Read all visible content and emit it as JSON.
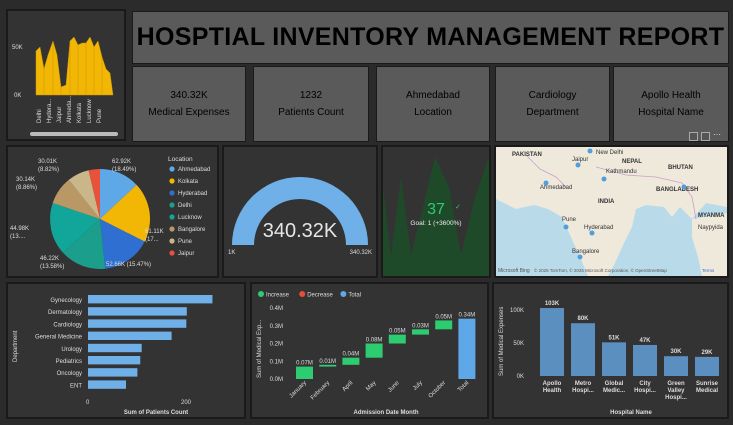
{
  "title": "HOSPTIAL INVENTORY MANAGEMENT REPORT",
  "cards": [
    {
      "value": "340.32K",
      "label": "Medical Expenses"
    },
    {
      "value": "1232",
      "label": "Patients Count"
    },
    {
      "value": "Ahmedabad",
      "label": "Location"
    },
    {
      "value": "Cardiology",
      "label": "Department"
    },
    {
      "value": "Apollo Health",
      "label": "Hospital Name"
    }
  ],
  "area_chart": {
    "y_ticks": [
      "50K",
      "0K"
    ],
    "categories": [
      "Delhi",
      "Hydera...",
      "Jaipur",
      "Ahmeda...",
      "Kolkata",
      "Lucknow",
      "Pune"
    ]
  },
  "pie": {
    "legend_title": "Location",
    "legend": [
      {
        "name": "Ahmedabad",
        "color": "#5fa8e8"
      },
      {
        "name": "Kolkata",
        "color": "#f2b705"
      },
      {
        "name": "Hyderabad",
        "color": "#2f6fd1"
      },
      {
        "name": "Delhi",
        "color": "#1b9e8c"
      },
      {
        "name": "Lucknow",
        "color": "#12a59a"
      },
      {
        "name": "Bangalore",
        "color": "#b99866"
      },
      {
        "name": "Pune",
        "color": "#c9b78a"
      },
      {
        "name": "Jaipur",
        "color": "#e8523c"
      }
    ],
    "labels": {
      "a": "62.92K",
      "a2": "(18.49%)",
      "b": "61.11K",
      "b2": "(17...",
      "c": "52.66K (15.47%)",
      "d": "46.22K",
      "d2": "(13.58%)",
      "e": "44.98K",
      "e2": "(13....",
      "f": "30.14K",
      "f2": "(8.86%)",
      "g": "30.01K",
      "g2": "(8.82%)"
    }
  },
  "gauge": {
    "value": "340.32K",
    "min": "1K",
    "max": "340.32K",
    "fraction": 1.0,
    "color": "#6fb0e8"
  },
  "kpi": {
    "value": "37",
    "goal": "Goal: 1 (+3600%)"
  },
  "map": {
    "labels": [
      "PAKISTAN",
      "New Delhi",
      "Jaipur",
      "Kathmandu",
      "NEPAL",
      "BHUTAN",
      "Ahmedabad",
      "BANGLADESH",
      "INDIA",
      "MYANMA",
      "Pune",
      "Hyderabad",
      "Naypyida",
      "Bangalore"
    ],
    "footer": "Microsoft Bing",
    "copyright": "© 2025 TomTom, © 2025 Microsoft Corporation, © OpenStreetMap",
    "terms": "Terms"
  },
  "bar_dept": {
    "ylabel": "Department",
    "xlabel": "Sum of Patients Count",
    "x_ticks": [
      "0",
      "200"
    ],
    "categories": [
      "Gynecology",
      "Dermatology",
      "Cardiology",
      "General Medicine",
      "Urology",
      "Pediatrics",
      "Oncology",
      "ENT"
    ],
    "values": [
      262,
      208,
      207,
      176,
      113,
      110,
      104,
      80
    ],
    "color": "#6fb0e8"
  },
  "waterfall": {
    "legend": [
      {
        "name": "Increase",
        "color": "#2ecc71"
      },
      {
        "name": "Decrease",
        "color": "#e74c3c"
      },
      {
        "name": "Total",
        "color": "#5fa8e8"
      }
    ],
    "ylabel": "Sum of Medical Exp...",
    "xlabel": "Admission Date Month",
    "y_ticks": [
      "0.4M",
      "0.3M",
      "0.2M",
      "0.1M",
      "0.0M"
    ],
    "categories": [
      "January",
      "February",
      "April",
      "May",
      "June",
      "July",
      "October",
      "Total"
    ],
    "value_labels": [
      "0.07M",
      "0.01M",
      "0.04M",
      "0.08M",
      "0.05M",
      "0.03M",
      "0.05M",
      "0.34M"
    ],
    "values": [
      0.07,
      0.01,
      0.04,
      0.08,
      0.05,
      0.03,
      0.05,
      0.34
    ]
  },
  "bar_hosp": {
    "ylabel": "Sum of Medical Expenses",
    "xlabel": "Hospital Name",
    "y_ticks": [
      "100K",
      "50K",
      "0K"
    ],
    "categories": [
      "Apollo Health",
      "Metro Hospi...",
      "Global Medic...",
      "City Hospi...",
      "Green Valley Hospi...",
      "Sunrise Medical"
    ],
    "value_labels": [
      "103K",
      "80K",
      "51K",
      "47K",
      "30K",
      "29K"
    ],
    "values": [
      103,
      80,
      51,
      47,
      30,
      29
    ],
    "color": "#5b8fbf"
  }
}
